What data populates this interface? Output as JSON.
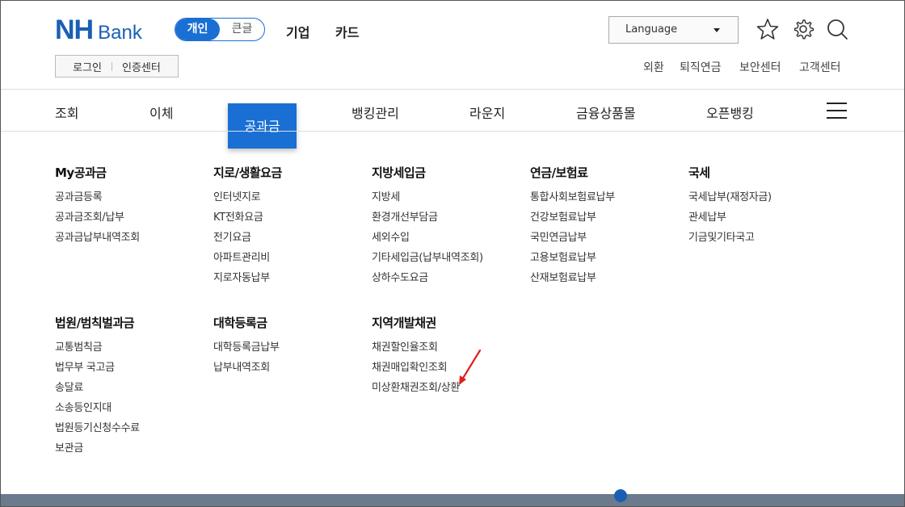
{
  "logo": {
    "nh": "NH",
    "bank": "Bank",
    "color": "#1a5fb4"
  },
  "segment": {
    "active": "개인",
    "inactive": "큰글"
  },
  "top_nav": [
    "기업",
    "카드"
  ],
  "login": {
    "login": "로그인",
    "cert": "인증센터"
  },
  "language": {
    "label": "Language"
  },
  "header_icons": [
    "star-icon",
    "gear-icon",
    "search-icon"
  ],
  "utility_links": [
    "외환",
    "퇴직연금",
    "보안센터",
    "고객센터"
  ],
  "main_nav": {
    "items": [
      "조회",
      "이체",
      "공과금",
      "뱅킹관리",
      "라운지",
      "금융상품몰",
      "오픈뱅킹"
    ],
    "active": "공과금",
    "accent": "#1a6fd4"
  },
  "mega_menu": {
    "row1": [
      {
        "title": "My공과금",
        "items": [
          "공과금등록",
          "공과금조회/납부",
          "공과금납부내역조회"
        ]
      },
      {
        "title": "지로/생활요금",
        "items": [
          "인터넷지로",
          "KT전화요금",
          "전기요금",
          "아파트관리비",
          "지로자동납부"
        ]
      },
      {
        "title": "지방세입금",
        "items": [
          "지방세",
          "환경개선부담금",
          "세외수입",
          "기타세입금(납부내역조회)",
          "상하수도요금"
        ]
      },
      {
        "title": "연금/보험료",
        "items": [
          "통합사회보험료납부",
          "건강보험료납부",
          "국민연금납부",
          "고용보험료납부",
          "산재보험료납부"
        ]
      },
      {
        "title": "국세",
        "items": [
          "국세납부(재정자금)",
          "관세납부",
          "기금및기타국고"
        ]
      }
    ],
    "row2": [
      {
        "title": "법원/범칙벌과금",
        "items": [
          "교통범칙금",
          "법무부 국고금",
          "송달료",
          "소송등인지대",
          "법원등기신청수수료",
          "보관금"
        ]
      },
      {
        "title": "대학등록금",
        "items": [
          "대학등록금납부",
          "납부내역조회"
        ]
      },
      {
        "title": "지역개발채권",
        "items": [
          "채권할인율조회",
          "채권매입확인조회",
          "미상환채권조회/상환"
        ]
      }
    ]
  },
  "annotation": {
    "color": "#e02020"
  }
}
